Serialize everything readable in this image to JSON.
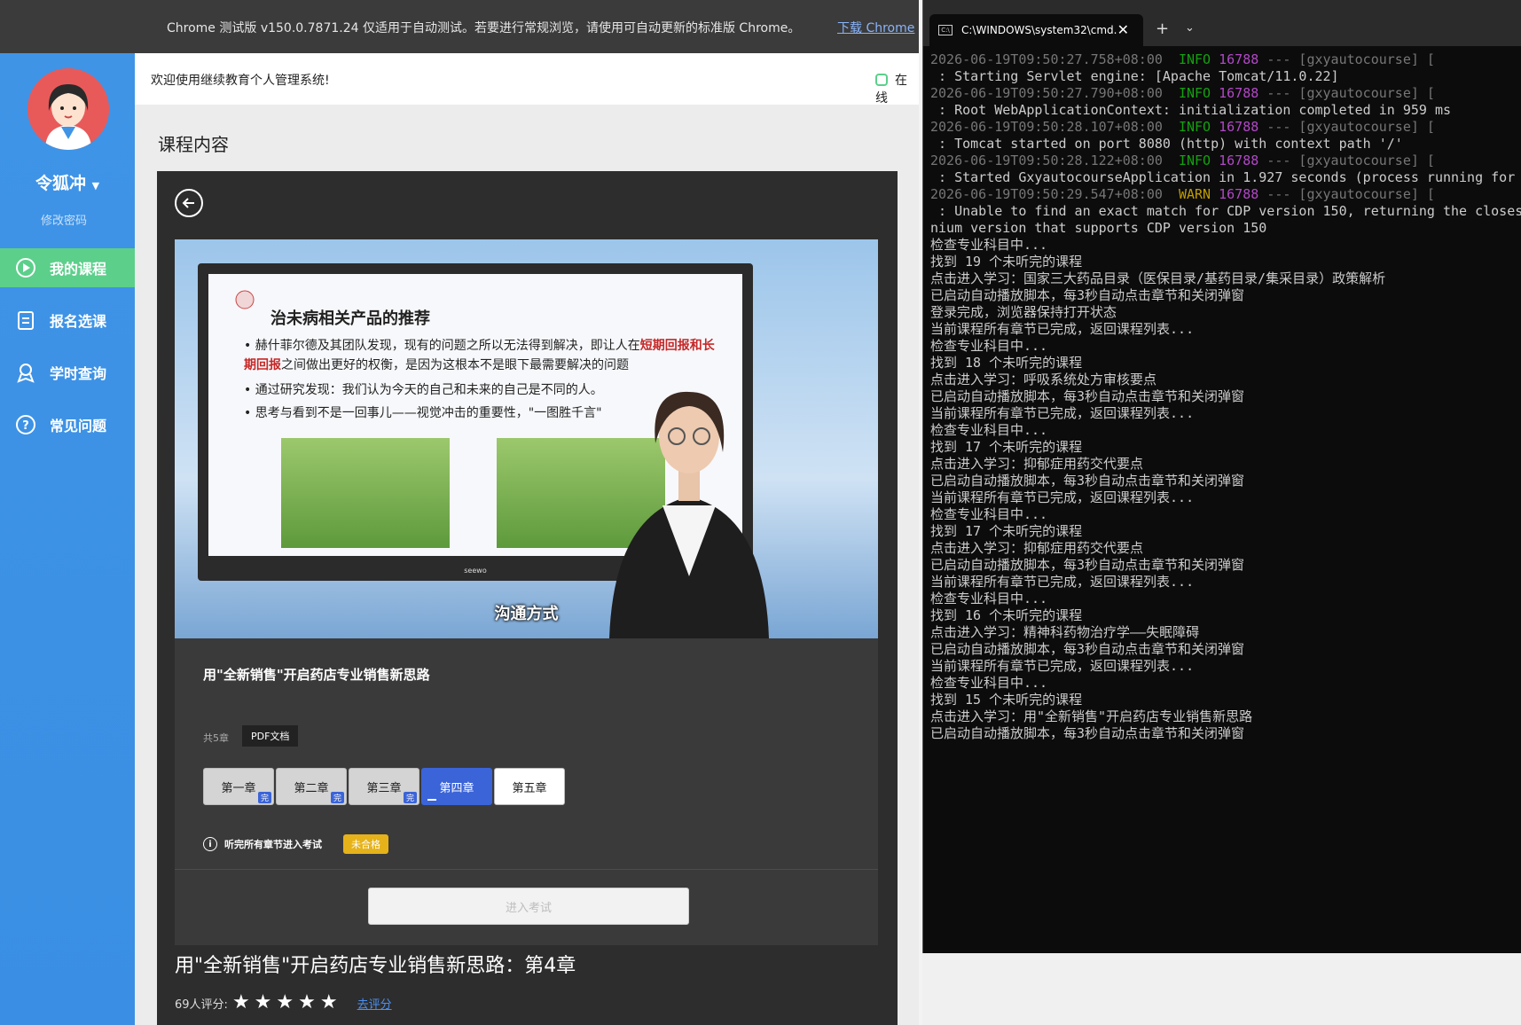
{
  "chrome": {
    "infobar_text": "Chrome 测试版 v150.0.7871.24 仅适用于自动测试。若要进行常规浏览，请使用可自动更新的标准版 Chrome。",
    "download_link": "下载 Chrome"
  },
  "sidebar": {
    "username": "令狐冲",
    "change_password": "修改密码",
    "items": [
      {
        "label": "我的课程",
        "icon": "play-circle-icon",
        "active": true
      },
      {
        "label": "报名选课",
        "icon": "clipboard-icon",
        "active": false
      },
      {
        "label": "学时查询",
        "icon": "award-icon",
        "active": false
      },
      {
        "label": "常见问题",
        "icon": "question-icon",
        "active": false
      }
    ]
  },
  "header": {
    "welcome": "欢迎使用继续教育个人管理系统!",
    "online": "在线"
  },
  "section_title": "课程内容",
  "player": {
    "slide_title": "治未病相关产品的推荐",
    "bullet1_a": "赫什菲尔德及其团队发现，现有的问题之所以无法得到解决，即让人在",
    "bullet1_b": "短期回报",
    "bullet1_c": "和长期回报",
    "bullet1_d": "之间做出更好的权衡，是因为这根本不是眼下最需要解决的问题",
    "bullet2": "通过研究发现：我们认为今天的自己和未来的自己是不同的人。",
    "bullet3": "思考与看到不是一回事儿——视觉冲击的重要性，\"一图胜千言\"",
    "brand": "seewo",
    "subtitle": "沟通方式"
  },
  "course": {
    "title": "用\"全新销售\"开启药店专业销售新思路",
    "chapter_count": "共5章",
    "doc_badge": "PDF文档",
    "chapters": [
      {
        "label": "第一章",
        "status": "完"
      },
      {
        "label": "第二章",
        "status": "完"
      },
      {
        "label": "第三章",
        "status": "完"
      },
      {
        "label": "第四章",
        "status": "current"
      },
      {
        "label": "第五章",
        "status": "todo"
      }
    ],
    "exam_hint": "听完所有章节进入考试",
    "exam_status": "未合格",
    "exam_button": "进入考试",
    "big_title": "用\"全新销售\"开启药店专业销售新思路：第4章",
    "rating_count": "69人评分:",
    "stars": 5,
    "rate_link": "去评分"
  },
  "terminal": {
    "tab_title": "C:\\WINDOWS\\system32\\cmd.",
    "lines": [
      {
        "ts": "2026-06-19T09:50:27.758+08:00",
        "level": "INFO",
        "pid": "16788",
        "tag": "--- [gxyautocourse] [",
        "msg": " : Starting Servlet engine: [Apache Tomcat/11.0.22]"
      },
      {
        "ts": "2026-06-19T09:50:27.790+08:00",
        "level": "INFO",
        "pid": "16788",
        "tag": "--- [gxyautocourse] [",
        "msg": " : Root WebApplicationContext: initialization completed in 959 ms"
      },
      {
        "ts": "2026-06-19T09:50:28.107+08:00",
        "level": "INFO",
        "pid": "16788",
        "tag": "--- [gxyautocourse] [",
        "msg": " : Tomcat started on port 8080 (http) with context path '/'"
      },
      {
        "ts": "2026-06-19T09:50:28.122+08:00",
        "level": "INFO",
        "pid": "16788",
        "tag": "--- [gxyautocourse] [",
        "msg": " : Started GxyautocourseApplication in 1.927 seconds (process running for"
      },
      {
        "ts": "2026-06-19T09:50:29.547+08:00",
        "level": "WARN",
        "pid": "16788",
        "tag": "--- [gxyautocourse] [",
        "msg": " : Unable to find an exact match for CDP version 150, returning the closes"
      }
    ],
    "plain": [
      "nium version that supports CDP version 150",
      "检查专业科目中...",
      "找到 19 个未听完的课程",
      "点击进入学习：国家三大药品目录（医保目录/基药目录/集采目录）政策解析",
      "已启动自动播放脚本，每3秒自动点击章节和关闭弹窗",
      "登录完成，浏览器保持打开状态",
      "当前课程所有章节已完成，返回课程列表...",
      "检查专业科目中...",
      "找到 18 个未听完的课程",
      "点击进入学习：呼吸系统处方审核要点",
      "已启动自动播放脚本，每3秒自动点击章节和关闭弹窗",
      "当前课程所有章节已完成，返回课程列表...",
      "检查专业科目中...",
      "找到 17 个未听完的课程",
      "点击进入学习：抑郁症用药交代要点",
      "已启动自动播放脚本，每3秒自动点击章节和关闭弹窗",
      "当前课程所有章节已完成，返回课程列表...",
      "检查专业科目中...",
      "找到 17 个未听完的课程",
      "点击进入学习：抑郁症用药交代要点",
      "已启动自动播放脚本，每3秒自动点击章节和关闭弹窗",
      "当前课程所有章节已完成，返回课程列表...",
      "检查专业科目中...",
      "找到 16 个未听完的课程",
      "点击进入学习：精神科药物治疗学——失眠障碍",
      "已启动自动播放脚本，每3秒自动点击章节和关闭弹窗",
      "当前课程所有章节已完成，返回课程列表...",
      "检查专业科目中...",
      "找到 15 个未听完的课程",
      "点击进入学习：用\"全新销售\"开启药店专业销售新思路",
      "已启动自动播放脚本，每3秒自动点击章节和关闭弹窗"
    ]
  },
  "colors": {
    "sidebar_blue": "#3f94e6",
    "active_green": "#5ccf8b",
    "chapter_current": "#3b64d8",
    "fail_badge": "#e5b21a"
  }
}
